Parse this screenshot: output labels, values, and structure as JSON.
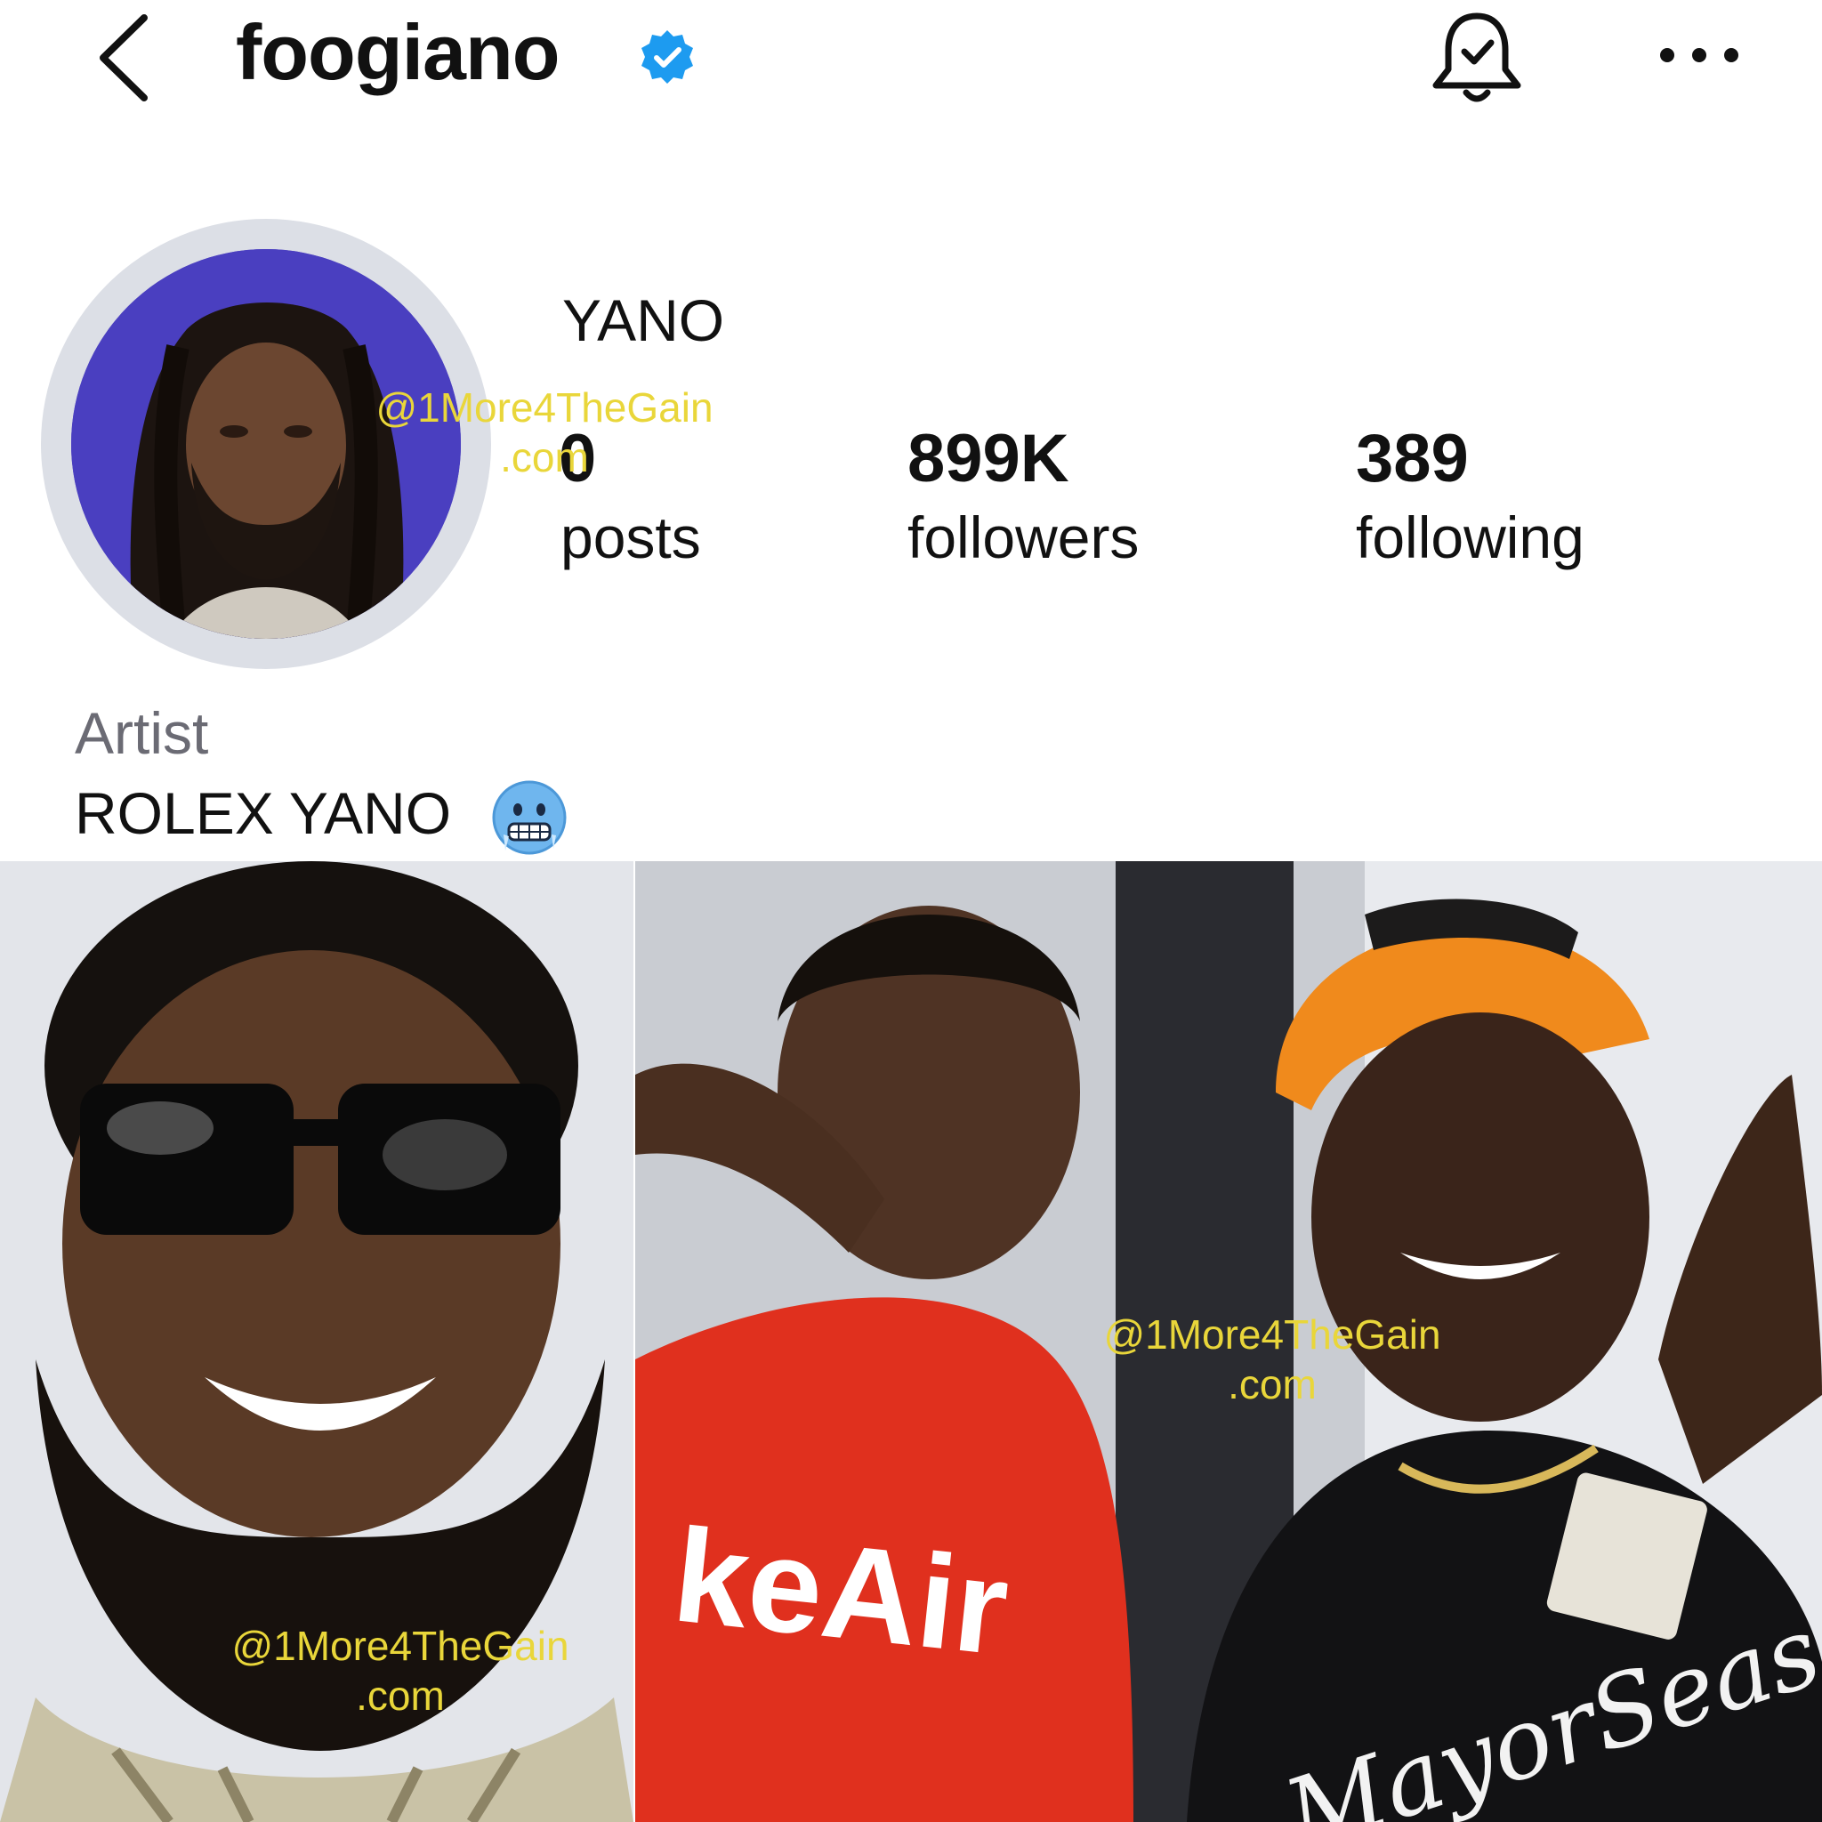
{
  "header": {
    "username": "foogiano",
    "back_icon": "chevron-left-icon",
    "verified_icon": "verified-badge-icon",
    "bell_icon": "notification-bell-icon",
    "more_icon": "more-dots-icon"
  },
  "profile": {
    "display_name": "YANO",
    "stats": {
      "posts": {
        "value": "0",
        "label": "posts"
      },
      "followers": {
        "value": "899K",
        "label": "followers"
      },
      "following": {
        "value": "389",
        "label": "following"
      }
    },
    "category": "Artist",
    "bio": "ROLEX YANO",
    "bio_emoji": "cold-face-emoji"
  },
  "watermark": {
    "line1": "@1More4TheGain",
    "line2": ".com"
  },
  "colors": {
    "verified_blue": "#1d9bf0",
    "watermark_yellow": "#e9d63a",
    "avatar_bg": "#4a3fc0",
    "category_gray": "#6b6b74"
  }
}
